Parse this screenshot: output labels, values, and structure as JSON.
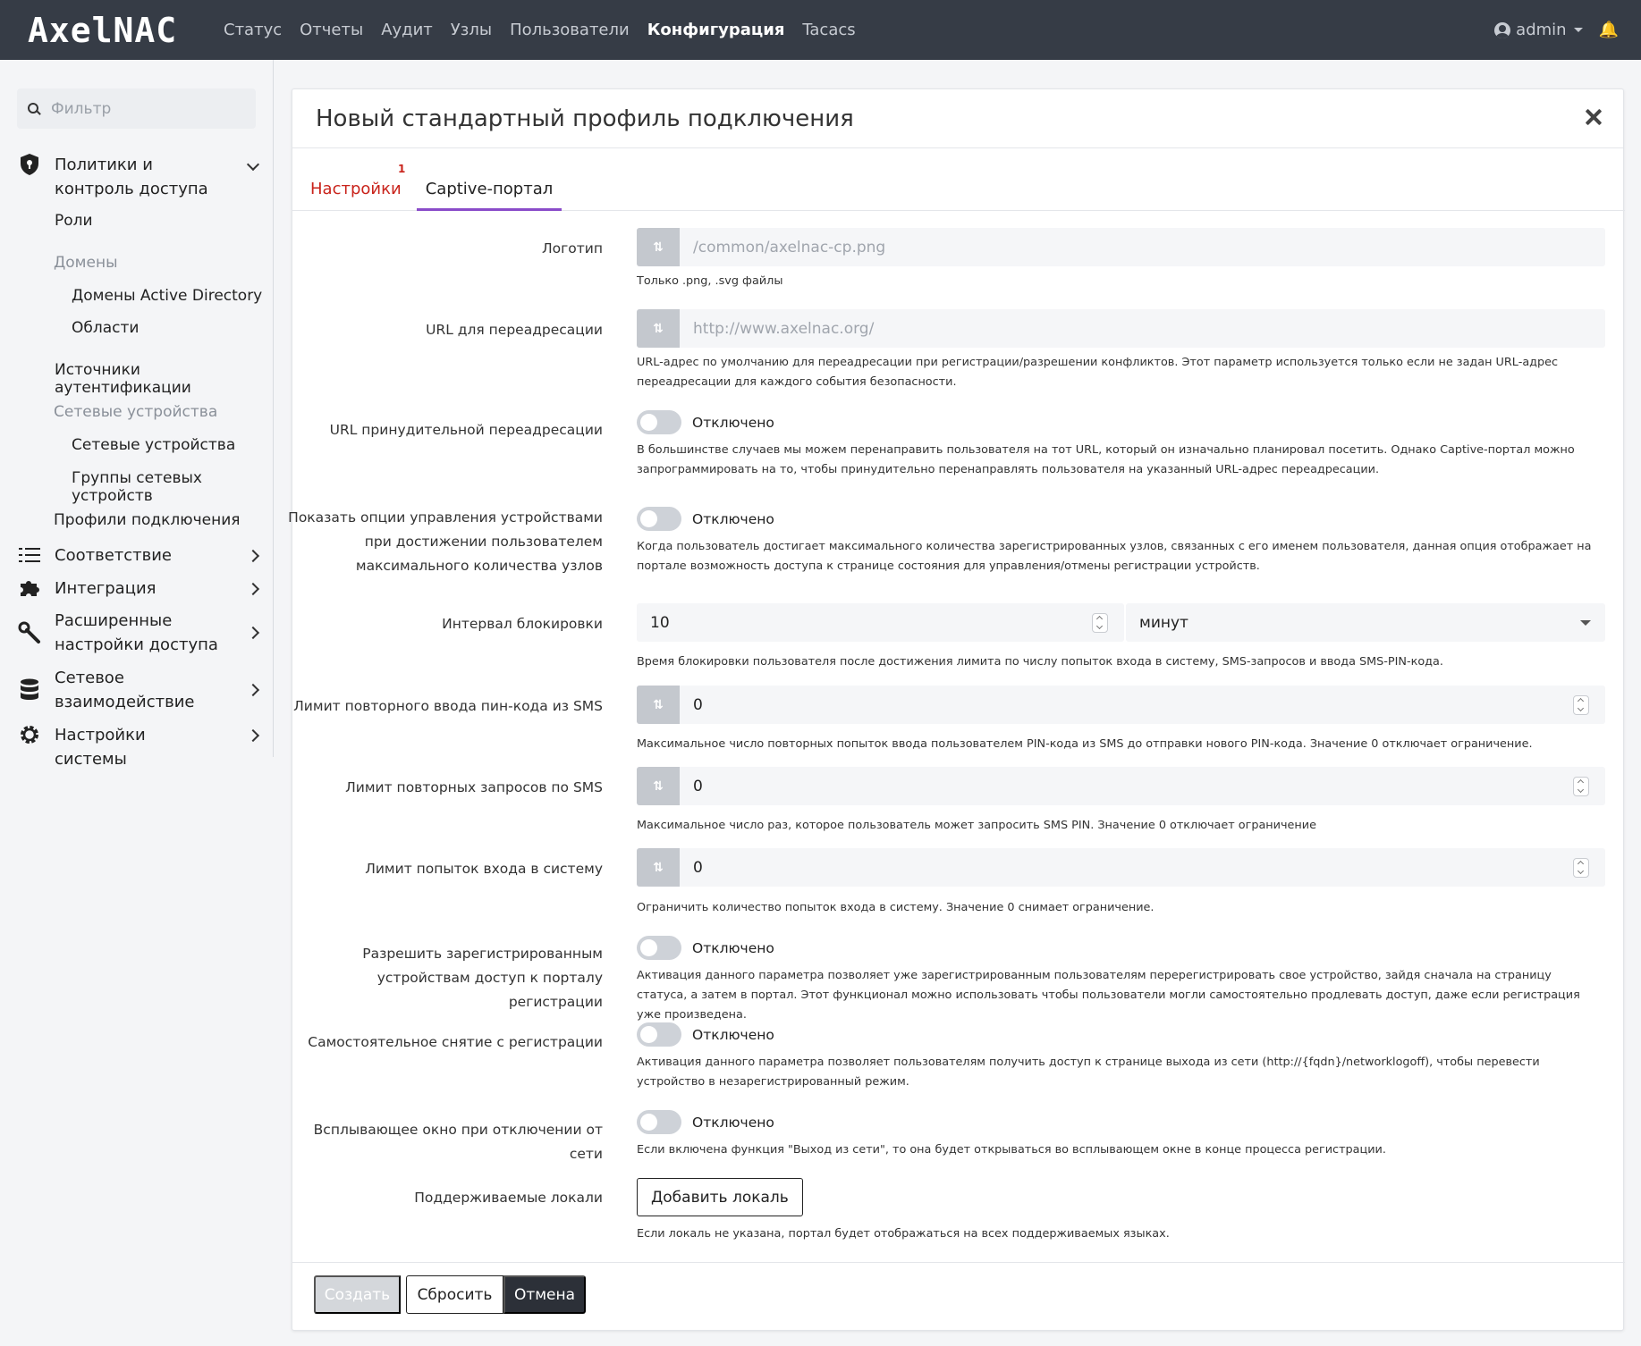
{
  "brand": "AxelNAC",
  "nav": {
    "items": [
      "Статус",
      "Отчеты",
      "Аудит",
      "Узлы",
      "Пользователи",
      "Конфигурация",
      "Tacacs"
    ],
    "active": "Конфигурация",
    "user": "admin"
  },
  "sidebar": {
    "filter_placeholder": "Фильтр",
    "policies": "Политики и контроль доступа",
    "roles": "Роли",
    "domains": "Домены",
    "ad_domains": "Домены Active Directory",
    "realms": "Области",
    "auth_sources": "Источники аутентификации",
    "network_devices_header": "Сетевые устройства",
    "network_devices": "Сетевые устройства",
    "network_device_groups": "Группы сетевых устройств",
    "connection_profiles": "Профили подключения",
    "compliance": "Соответствие",
    "integration": "Интеграция",
    "advanced_access": "Расширенные настройки доступа",
    "networking": "Сетевое взаимодействие",
    "system_settings": "Настройки системы"
  },
  "modal": {
    "title": "Новый стандартный профиль подключения",
    "tabs": {
      "settings": "Настройки",
      "settings_badge": "1",
      "captive": "Captive-портал"
    },
    "logo": {
      "label": "Логотип",
      "placeholder": "/common/axelnac-cp.png",
      "help": "Только .png, .svg файлы"
    },
    "redirect_url": {
      "label": "URL для переадресации",
      "placeholder": "http://www.axelnac.org/",
      "help": "URL-адрес по умолчанию для переадресации при регистрации/разрешении конфликтов. Этот параметр используется только если не задан URL-адрес переадресации для каждого события безопасности."
    },
    "force_redirect": {
      "label": "URL принудительной переадресации",
      "state": "Отключено",
      "help": "В большинстве случаев мы можем перенаправить пользователя на тот URL, который он изначально планировал посетить. Однако Captive-портал можно запрограммировать на то, чтобы принудительно перенаправлять пользователя на указанный URL-адрес переадресации."
    },
    "device_mgmt": {
      "label": "Показать опции управления устройствами при достижении пользователем максимального количества узлов",
      "state": "Отключено",
      "help": "Когда пользователь достигает максимального количества зарегистрированных узлов, связанных с его именем пользователя, данная опция отображает на портале возможность доступа к странице состояния для управления/отмены регистрации устройств."
    },
    "block_interval": {
      "label": "Интервал блокировки",
      "value": "10",
      "unit": "минут",
      "help": "Время блокировки пользователя после достижения лимита по числу попыток входа в систему, SMS-запросов и ввода SMS-PIN-кода."
    },
    "sms_pin_retry": {
      "label": "Лимит повторного ввода пин-кода из SMS",
      "value": "0",
      "help": "Максимальное число повторных попыток ввода пользователем PIN-кода из SMS до отправки нового PIN-кода. Значение 0 отключает ограничение."
    },
    "sms_request": {
      "label": "Лимит повторных запросов по SMS",
      "value": "0",
      "help": "Максимальное число раз, которое пользователь может запросить SMS PIN. Значение 0 отключает ограничение"
    },
    "login_attempts": {
      "label": "Лимит попыток входа в систему",
      "value": "0",
      "help": "Ограничить количество попыток входа в систему. Значение 0 снимает ограничение."
    },
    "reg_access": {
      "label": "Разрешить зарегистрированным устройствам доступ к порталу регистрации",
      "state": "Отключено",
      "help": "Активация данного параметра позволяет уже зарегистрированным пользователям перерегистрировать свое устройство, зайдя сначала на страницу статуса, а затем в портал. Этот функционал можно использовать чтобы пользователи могли самостоятельно продлевать доступ, даже если регистрация уже произведена."
    },
    "self_unreg": {
      "label": "Самостоятельное снятие с регистрации",
      "state": "Отключено",
      "help": "Активация данного параметра позволяет пользователям получить доступ к странице выхода из сети (http://{fqdn}/networklogoff), чтобы перевести устройство в незарегистрированный режим."
    },
    "logoff_popup": {
      "label": "Всплывающее окно при отключении от сети",
      "state": "Отключено",
      "help": "Если включена функция \"Выход из сети\", то она будет открываться во всплывающем окне в конце процесса регистрации."
    },
    "locales": {
      "label": "Поддерживаемые локали",
      "button": "Добавить локаль",
      "help": "Если локаль не указана, портал будет отображаться на всех поддерживаемых языках."
    },
    "footer": {
      "create": "Создать",
      "reset": "Сбросить",
      "cancel": "Отмена"
    }
  }
}
